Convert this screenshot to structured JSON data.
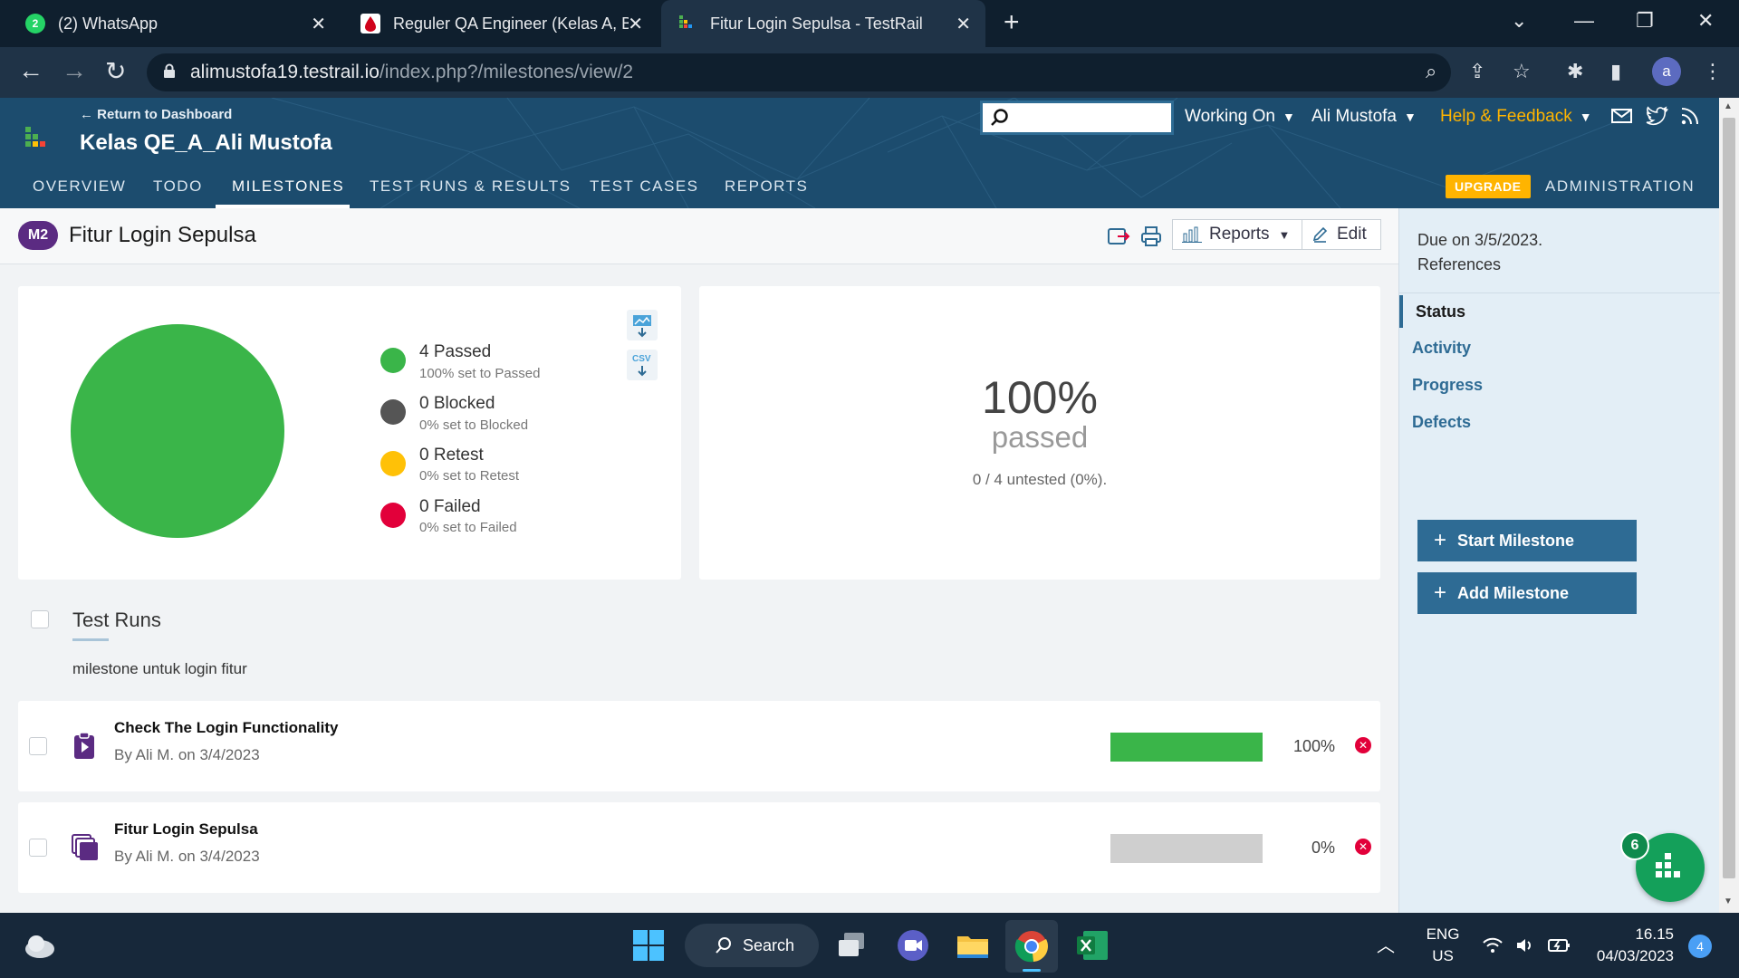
{
  "browser": {
    "tabs": [
      {
        "title": "(2) WhatsApp",
        "badge": "2"
      },
      {
        "title": "Reguler QA Engineer (Kelas A, B,"
      },
      {
        "title": "Fitur Login Sepulsa - TestRail"
      }
    ],
    "url_host": "alimustofa19.testrail.io",
    "url_path": "/index.php?/milestones/view/2",
    "profile_initial": "a"
  },
  "header": {
    "return_link": "← Return to Dashboard",
    "project_name": "Kelas QE_A_Ali Mustofa",
    "search_placeholder": "",
    "working_on": "Working On",
    "user_name": "Ali Mustofa",
    "help_feedback": "Help & Feedback",
    "nav_tabs": [
      "OVERVIEW",
      "TODO",
      "MILESTONES",
      "TEST RUNS & RESULTS",
      "TEST CASES",
      "REPORTS"
    ],
    "active_tab": "MILESTONES",
    "upgrade_label": "UPGRADE",
    "administration_label": "ADMINISTRATION"
  },
  "milestone": {
    "badge": "M2",
    "title": "Fitur Login Sepulsa",
    "reports_label": "Reports",
    "edit_label": "Edit"
  },
  "status_chart": {
    "legend": [
      {
        "label": "4 Passed",
        "sub": "100% set to Passed",
        "color": "#3ab549"
      },
      {
        "label": "0 Blocked",
        "sub": "0% set to Blocked",
        "color": "#555555"
      },
      {
        "label": "0 Retest",
        "sub": "0% set to Retest",
        "color": "#ffc107"
      },
      {
        "label": "0 Failed",
        "sub": "0% set to Failed",
        "color": "#e2003a"
      }
    ],
    "csv_label": "CSV"
  },
  "summary": {
    "percent": "100%",
    "passed_label": "passed",
    "untested": "0 / 4 untested (0%)."
  },
  "test_runs": {
    "title": "Test Runs",
    "description": "milestone untuk login fitur",
    "runs": [
      {
        "title": "Check The Login Functionality",
        "by": "By Ali M. on 3/4/2023",
        "progress": 100,
        "percent_label": "100%"
      },
      {
        "title": "Fitur Login Sepulsa",
        "by": "By Ali M. on 3/4/2023",
        "progress": 0,
        "percent_label": "0%"
      }
    ]
  },
  "sidebar": {
    "due": "Due on 3/5/2023.",
    "references": "References",
    "links": [
      "Status",
      "Activity",
      "Progress",
      "Defects"
    ],
    "active_link": "Status",
    "start_milestone": "Start Milestone",
    "add_milestone": "Add Milestone",
    "help_count": "6"
  },
  "taskbar": {
    "search_label": "Search",
    "language_top": "ENG",
    "language_bottom": "US",
    "time": "16.15",
    "date": "04/03/2023",
    "notification_count": "4"
  },
  "colors": {
    "brand_header": "#1c4c6e",
    "passed": "#3ab549",
    "accent": "#2e6b94",
    "upgrade": "#ffb400"
  }
}
